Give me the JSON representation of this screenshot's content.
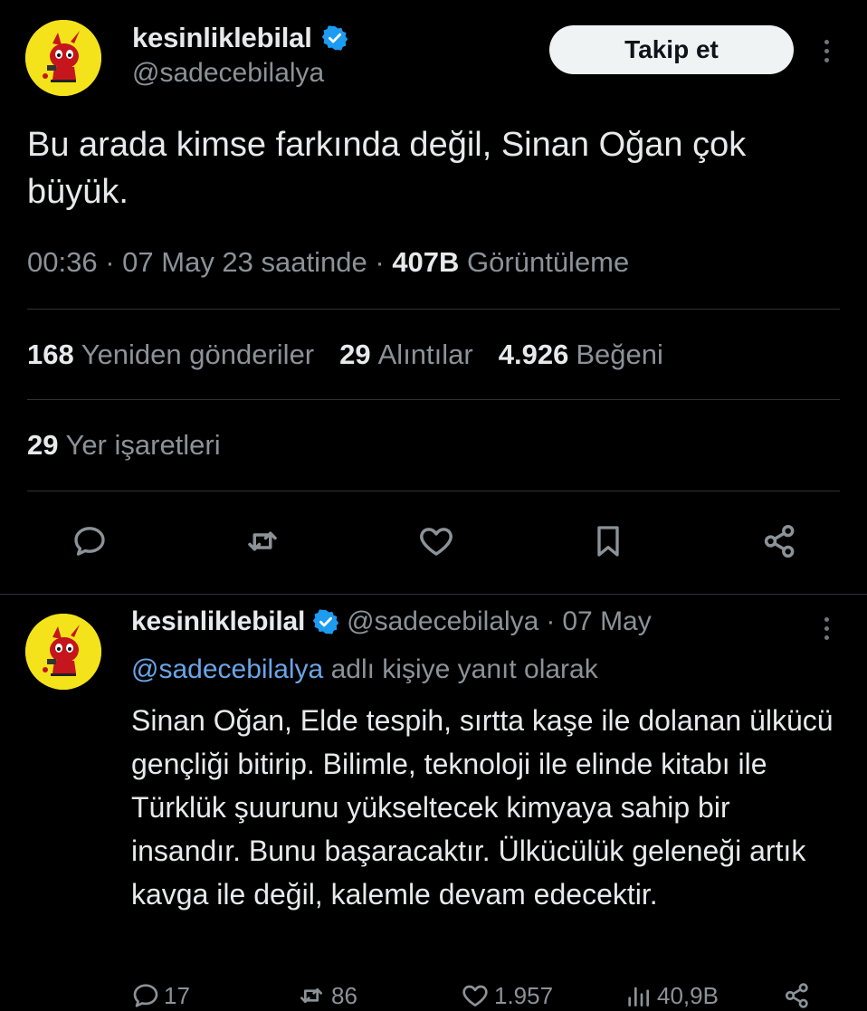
{
  "main_tweet": {
    "author_name": "kesinliklebilal",
    "author_handle": "@sadecebilalya",
    "follow_label": "Takip et",
    "text": "Bu arada kimse farkında değil, Sinan Oğan çok büyük.",
    "time": "00:36",
    "date_text": "07 May 23 saatinde",
    "views_count": "407B",
    "views_label": "Görüntüleme",
    "separator": "·",
    "stats": {
      "retweets_count": "168",
      "retweets_label": "Yeniden gönderiler",
      "quotes_count": "29",
      "quotes_label": "Alıntılar",
      "likes_count": "4.926",
      "likes_label": "Beğeni",
      "bookmarks_count": "29",
      "bookmarks_label": "Yer işaretleri"
    },
    "actions": [
      "reply-icon",
      "retweet-icon",
      "heart-icon",
      "bookmark-icon",
      "share-icon"
    ]
  },
  "reply_tweet": {
    "author_name": "kesinliklebilal",
    "author_handle": "@sadecebilalya",
    "separator": "·",
    "date": "07 May",
    "replying_mention": "@sadecebilalya",
    "replying_suffix": "adlı kişiye yanıt olarak",
    "text": "Sinan Oğan, Elde tespih, sırtta kaşe ile dolanan ülkücü gençliği bitirip. Bilimle, teknoloji ile elinde kitabı ile Türklük şuurunu yükseltecek kimyaya sahip bir insandır. Bunu başaracaktır. Ülkücülük geleneği artık kavga ile değil, kalemle devam edecektir.",
    "counts": {
      "replies": "17",
      "retweets": "86",
      "likes": "1.957",
      "views": "40,9B"
    }
  },
  "colors": {
    "background": "#000000",
    "text_primary": "#e7e9ea",
    "text_secondary": "#8b9298",
    "divider": "#2f3336",
    "verified_blue": "#1d9bf0",
    "mention_blue": "#6aa5e8",
    "avatar_yellow": "#f4e31a",
    "follow_button_bg": "#eff3f4"
  }
}
